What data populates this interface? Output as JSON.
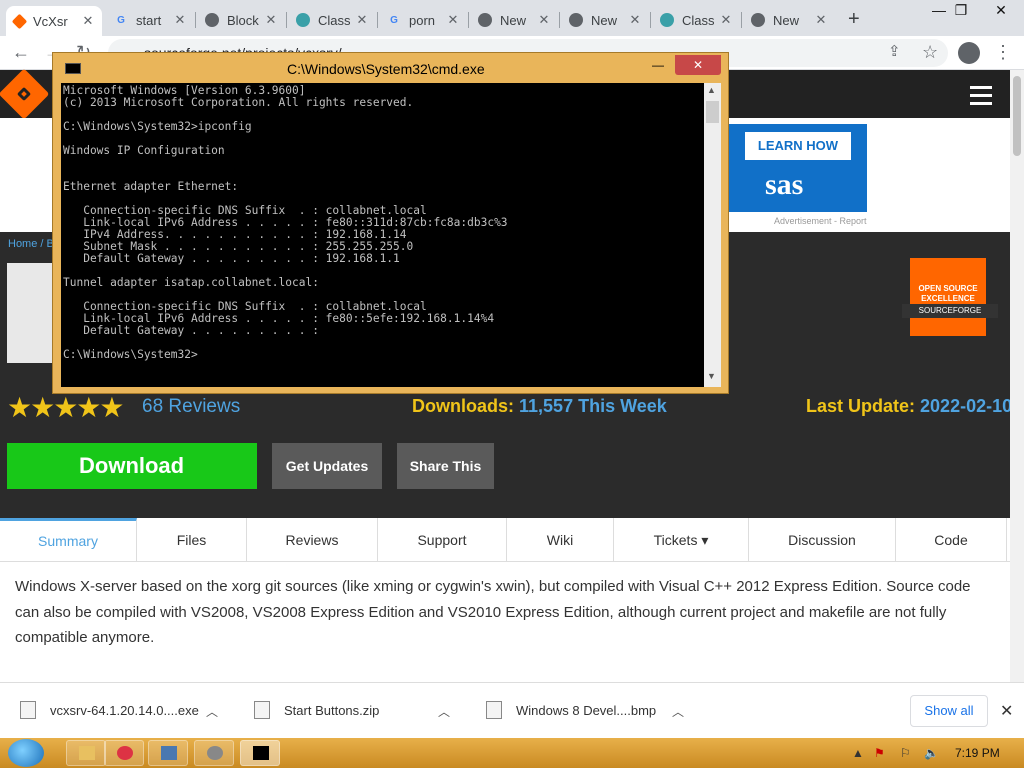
{
  "browser": {
    "tabs": [
      {
        "label": "VcXsr",
        "favicon": "sourceforge-icon",
        "active": true
      },
      {
        "label": "start",
        "favicon": "google-icon"
      },
      {
        "label": "Block",
        "favicon": "chrome-icon"
      },
      {
        "label": "Class",
        "favicon": "globe-icon"
      },
      {
        "label": "porn",
        "favicon": "google-icon"
      },
      {
        "label": "New",
        "favicon": "chrome-icon"
      },
      {
        "label": "New",
        "favicon": "chrome-icon"
      },
      {
        "label": "Class",
        "favicon": "globe-icon"
      },
      {
        "label": "New",
        "favicon": "chrome-icon"
      }
    ],
    "url": "sourceforge.net/projects/vcxsrv/"
  },
  "cmd": {
    "title": "C:\\Windows\\System32\\cmd.exe",
    "output": "Microsoft Windows [Version 6.3.9600]\n(c) 2013 Microsoft Corporation. All rights reserved.\n\nC:\\Windows\\System32>ipconfig\n\nWindows IP Configuration\n\n\nEthernet adapter Ethernet:\n\n   Connection-specific DNS Suffix  . : collabnet.local\n   Link-local IPv6 Address . . . . . : fe80::311d:87cb:fc8a:db3c%3\n   IPv4 Address. . . . . . . . . . . : 192.168.1.14\n   Subnet Mask . . . . . . . . . . . : 255.255.255.0\n   Default Gateway . . . . . . . . . : 192.168.1.1\n\nTunnel adapter isatap.collabnet.local:\n\n   Connection-specific DNS Suffix  . : collabnet.local\n   Link-local IPv6 Address . . . . . : fe80::5efe:192.168.1.14%4\n   Default Gateway . . . . . . . . . :\n\nC:\\Windows\\System32>"
  },
  "ad": {
    "cta": "LEARN HOW",
    "brand": "sas",
    "note": "Advertisement - Report"
  },
  "project": {
    "breadcrumb": "Home / B",
    "badge_title": "OPEN SOURCE EXCELLENCE",
    "badge_brand": "SOURCEFORGE",
    "reviews": "68 Reviews",
    "rating": 5,
    "downloads_label": "Downloads:",
    "downloads_value": "11,557 This Week",
    "last_update_label": "Last Update:",
    "last_update_value": "2022-02-10",
    "download_button": "Download",
    "get_updates_button": "Get Updates",
    "share_button": "Share This"
  },
  "nav": {
    "tabs": [
      "Summary",
      "Files",
      "Reviews",
      "Support",
      "Wiki",
      "Tickets ▾",
      "Discussion",
      "Code"
    ]
  },
  "description": "Windows X-server based on the xorg git sources (like xming or cygwin's xwin), but compiled with Visual C++ 2012 Express Edition. Source code can also be compiled with VS2008, VS2008 Express Edition and VS2010 Express Edition, although current project and makefile are not fully compatible anymore.",
  "downloads_shelf": {
    "items": [
      "vcxsrv-64.1.20.14.0....exe",
      "Start Buttons.zip",
      "Windows 8 Devel....bmp"
    ],
    "show_all": "Show all"
  },
  "taskbar": {
    "clock": "7:19 PM"
  },
  "colors": {
    "accent_blue": "#4fa3e0",
    "accent_yellow": "#f0c419",
    "download_green": "#18c818",
    "sourceforge_orange": "#ff6600"
  }
}
